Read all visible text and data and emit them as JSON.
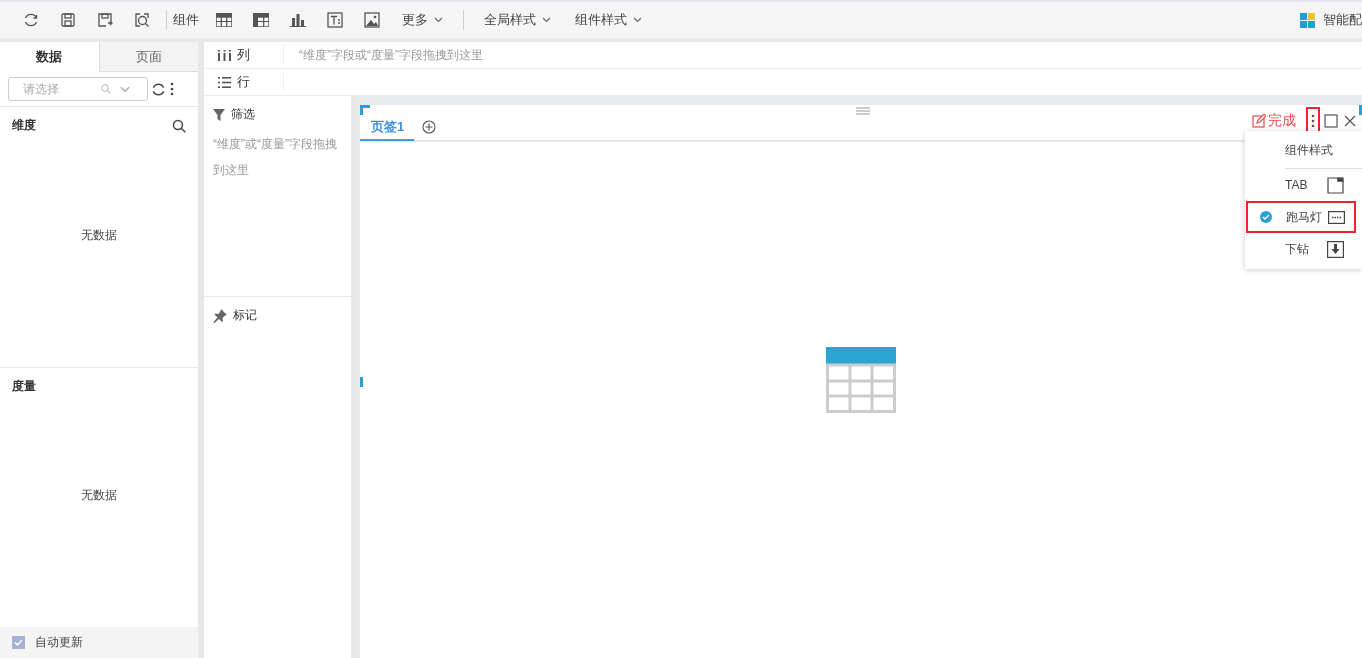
{
  "toolbar": {
    "component_label": "组件",
    "more": "更多",
    "global_style": "全局样式",
    "component_style": "组件样式",
    "smart_chart": "智能配"
  },
  "data_panel": {
    "tabs": [
      {
        "label": "数据",
        "selected": true
      },
      {
        "label": "页面",
        "selected": false
      }
    ],
    "search": {
      "placeholder": "请选择"
    },
    "sections": [
      {
        "title": "维度",
        "empty": "无数据"
      },
      {
        "title": "度量",
        "empty": "无数据"
      }
    ],
    "auto_update": {
      "label": "自动更新",
      "checked": true
    }
  },
  "shelves": {
    "columns": {
      "label": "列",
      "hint": "“维度”字段或“度量”字段拖拽到这里"
    },
    "rows": {
      "label": "行"
    },
    "filter": {
      "label": "筛选",
      "hint": "“维度”或“度量”字段拖拽到这里"
    },
    "marks": {
      "label": "标记"
    }
  },
  "widget": {
    "tabs": [
      {
        "label": "页签1",
        "selected": true
      }
    ],
    "done": "完成",
    "more_highlighted": true,
    "style_menu": {
      "title": "组件样式",
      "items": [
        {
          "label": "TAB",
          "selected": false,
          "highlighted": false
        },
        {
          "label": "跑马灯",
          "selected": true,
          "highlighted": true
        },
        {
          "label": "下钻",
          "selected": false,
          "highlighted": false
        }
      ]
    }
  }
}
